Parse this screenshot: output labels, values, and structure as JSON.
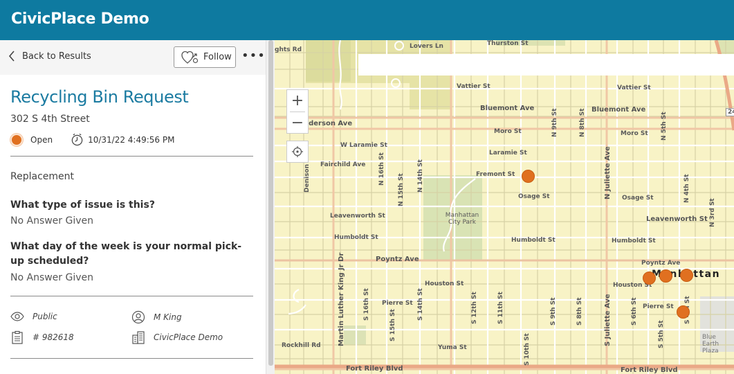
{
  "app": {
    "title": "CivicPlace Demo"
  },
  "nav": {
    "back_label": "Back to Results",
    "follow_label": "Follow",
    "more_label": "•••"
  },
  "request": {
    "title": "Recycling Bin Request",
    "address": "302 S 4th Street",
    "status": "Open",
    "status_color": "#e07020",
    "timestamp": "10/31/22 4:49:56 PM",
    "category": "Replacement",
    "questions": [
      {
        "label": "What type of issue is this?",
        "answer": "No Answer Given"
      },
      {
        "label": "What day of the week is your normal pick-up scheduled?",
        "answer": "No Answer Given"
      }
    ],
    "meta": {
      "visibility": "Public",
      "assignee": "M King",
      "id": "# 982618",
      "organization": "CivicPlace Demo"
    }
  },
  "map": {
    "zoom_in_label": "+",
    "zoom_out_label": "−",
    "street_labels": [
      "ghts Rd",
      "Lovers Ln",
      "Thurston St",
      "Vattier St",
      "Vattier St",
      "Bluemont Ave",
      "Bluemont Ave",
      "nderson Ave",
      "Moro St",
      "Moro St",
      "W Laramie St",
      "Laramie St",
      "Fairchild Ave",
      "Fremont St",
      "Osage St",
      "Osage St",
      "Leavenworth St",
      "Leavenworth St",
      "Humboldt St",
      "Humboldt St",
      "Humboldt St",
      "Poyntz Ave",
      "Poyntz Ave",
      "Houston St",
      "Houston St",
      "Pierre St",
      "Pierre St",
      "Rockhill Rd",
      "Yuma St",
      "Fort Riley Blvd",
      "Fort Riley Blvd",
      "Manhattan City Park",
      "Blue Earth Plaza",
      "N Juliette Ave",
      "S Juliette Ave",
      "Martin Luther King Jr Dr",
      "Denison",
      "N 14th St",
      "N 15th St",
      "N 16th St",
      "N 9th St",
      "N 8th St",
      "N 5th St",
      "N 4th St",
      "N 3rd St",
      "S 16th St",
      "S 15th St",
      "S 14th St",
      "S 12th St",
      "S 11th St",
      "S 10th St",
      "S 9th St",
      "S 8th St",
      "S 6th St",
      "S 5th St",
      "S 4th St",
      "24"
    ],
    "city_label": "Manhattan"
  }
}
